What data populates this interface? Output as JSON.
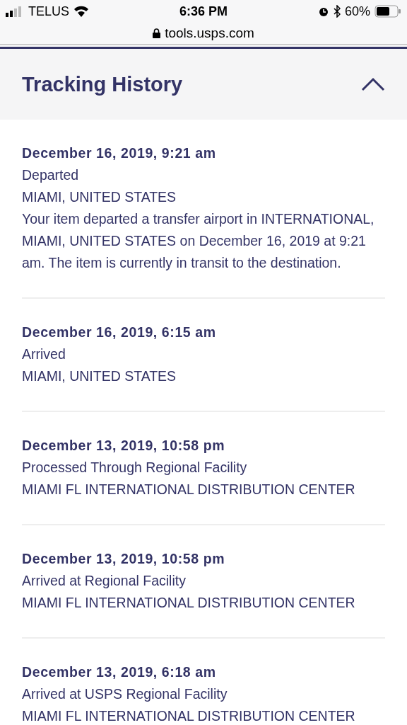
{
  "status_bar": {
    "carrier": "TELUS",
    "time": "6:36 PM",
    "battery": "60%"
  },
  "address_bar": {
    "url": "tools.usps.com"
  },
  "section": {
    "title": "Tracking History",
    "expanded": true
  },
  "events": [
    {
      "date": "December 16, 2019, 9:21 am",
      "status": "Departed",
      "location": "MIAMI, UNITED STATES",
      "detail": "Your item departed a transfer airport in INTERNATIONAL, MIAMI, UNITED STATES on December 16, 2019 at 9:21 am. The item is currently in transit to the destination."
    },
    {
      "date": "December 16, 2019, 6:15 am",
      "status": "Arrived",
      "location": "MIAMI, UNITED STATES"
    },
    {
      "date": "December 13, 2019, 10:58 pm",
      "status": "Processed Through Regional Facility",
      "location": "MIAMI FL INTERNATIONAL DISTRIBUTION CENTER"
    },
    {
      "date": "December 13, 2019, 10:58 pm",
      "status": "Arrived at Regional Facility",
      "location": "MIAMI FL INTERNATIONAL DISTRIBUTION CENTER"
    },
    {
      "date": "December 13, 2019, 6:18 am",
      "status": "Arrived at USPS Regional Facility",
      "location": "MIAMI FL INTERNATIONAL DISTRIBUTION CENTER"
    }
  ]
}
